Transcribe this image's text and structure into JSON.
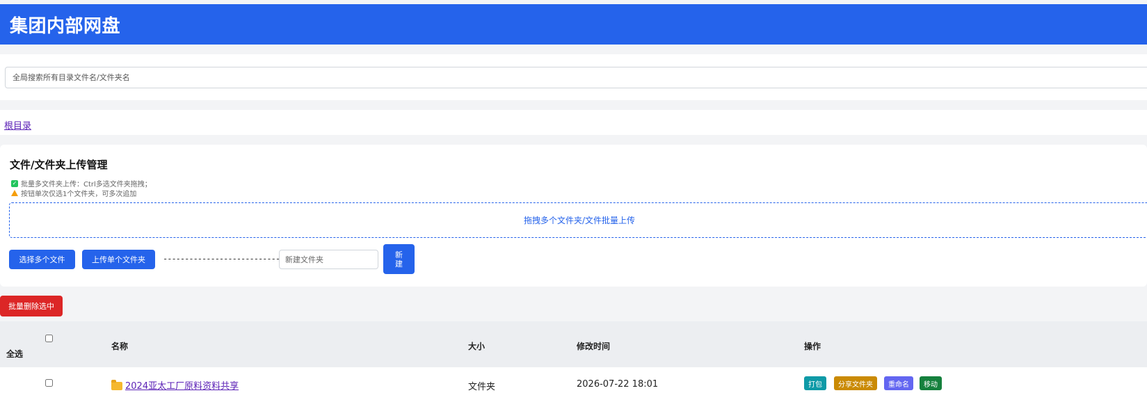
{
  "header": {
    "title": "集团内部网盘"
  },
  "search": {
    "placeholder": "全局搜索所有目录文件名/文件夹名",
    "value": ""
  },
  "breadcrumb": {
    "root_label": "根目录"
  },
  "upload": {
    "title": "文件/文件夹上传管理",
    "tip_batch": "批量多文件夹上传：Ctrl多选文件夹拖拽；",
    "tip_single": "按钮单次仅选1个文件夹，可多次追加",
    "dropzone_text": "拖拽多个文件夹/文件批量上传",
    "select_files_label": "选择多个文件",
    "upload_folder_label": "上传单个文件夹",
    "separator": "----------------------------",
    "new_folder_placeholder": "新建文件夹",
    "new_button_line1": "新",
    "new_button_line2": "建"
  },
  "toolbar": {
    "batch_delete_label": "批量删除选中"
  },
  "table": {
    "headers": {
      "select_all": "全选",
      "name": "名称",
      "size": "大小",
      "mtime": "修改时间",
      "actions": "操作"
    },
    "rows": [
      {
        "name": "2024亚太工厂原料资料共享",
        "size": "文件夹",
        "mtime": "2026-07-22 18:01",
        "actions": {
          "pack": "打包",
          "share": "分享文件夹",
          "rename": "重命名",
          "move": "移动"
        }
      }
    ]
  },
  "colors": {
    "primary": "#2563eb",
    "danger": "#dc2626",
    "pack": "#0e9aa7",
    "share": "#ca8a04",
    "rename": "#6366f1",
    "move": "#15803d"
  },
  "icons": {
    "tip_batch": "check-icon",
    "tip_single": "warning-icon",
    "row_folder": "folder-icon"
  }
}
